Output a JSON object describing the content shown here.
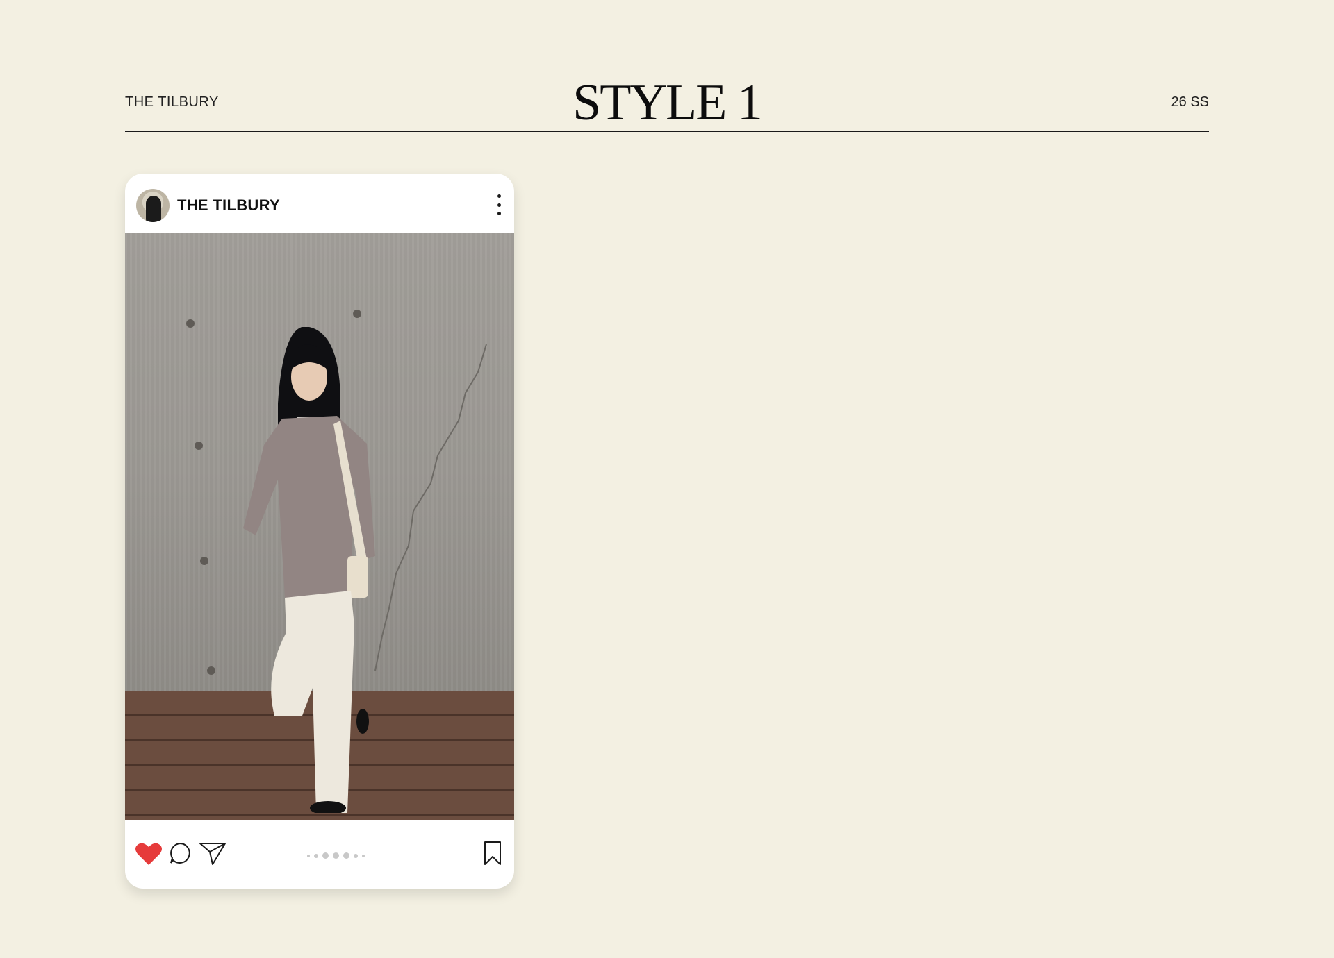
{
  "header": {
    "brand": "THE TILBURY",
    "title": "STYLE 1",
    "season": "26 SS"
  },
  "post": {
    "handle": "THE TILBURY",
    "liked": true,
    "carousel_count": 6,
    "colors": {
      "heart": "#e63b3b",
      "background": "#f3f0e2",
      "card": "#ffffff"
    },
    "icons": [
      "more-vertical-icon",
      "heart-icon",
      "comment-icon",
      "send-icon",
      "bookmark-icon"
    ]
  }
}
